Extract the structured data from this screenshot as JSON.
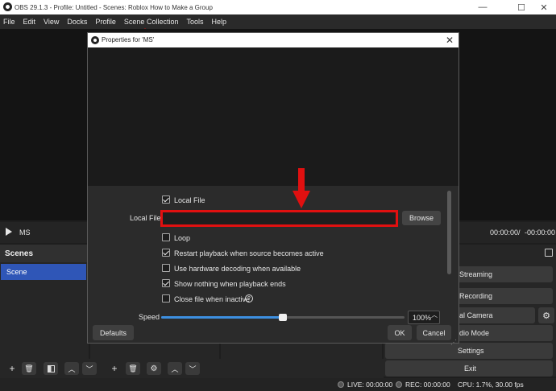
{
  "window": {
    "title": "OBS 29.1.3 - Profile: Untitled - Scenes: Roblox How to Make a Group",
    "minimize": "—",
    "maximize": "☐",
    "close": "✕"
  },
  "menu": [
    "File",
    "Edit",
    "View",
    "Docks",
    "Profile",
    "Scene Collection",
    "Tools",
    "Help"
  ],
  "source_bar": {
    "source_name": "MS",
    "time_current": "00:00:00",
    "time_separator": "/",
    "time_total": "-00:00:00"
  },
  "scenes": {
    "title": "Scenes",
    "items": [
      "Scene"
    ]
  },
  "controls": {
    "start_streaming": "t Streaming",
    "start_recording": "t Recording",
    "virtual_camera": "ual Camera",
    "studio_mode": "udio Mode",
    "settings": "Settings",
    "exit": "Exit"
  },
  "status": {
    "live": "LIVE: 00:00:00",
    "rec": "REC: 00:00:00",
    "cpu": "CPU: 1.7%, 30.00 fps"
  },
  "dialog": {
    "title": "Properties for 'MS'",
    "close": "✕",
    "local_file_checkbox": {
      "label": "Local File",
      "checked": true
    },
    "local_file_field_label": "Local File",
    "local_file_value": "",
    "browse_label": "Browse",
    "options": [
      {
        "label": "Loop",
        "checked": false
      },
      {
        "label": "Restart playback when source becomes active",
        "checked": true
      },
      {
        "label": "Use hardware decoding when available",
        "checked": false
      },
      {
        "label": "Show nothing when playback ends",
        "checked": true
      },
      {
        "label": "Close file when inactive",
        "checked": false
      }
    ],
    "speed_label": "Speed",
    "speed_value": "100%",
    "speed_fraction": 0.5,
    "defaults_label": "Defaults",
    "ok_label": "OK",
    "cancel_label": "Cancel"
  },
  "colors": {
    "highlight": "#e01010",
    "scene_selected": "#2f56b7",
    "slider": "#3d8fe0"
  }
}
